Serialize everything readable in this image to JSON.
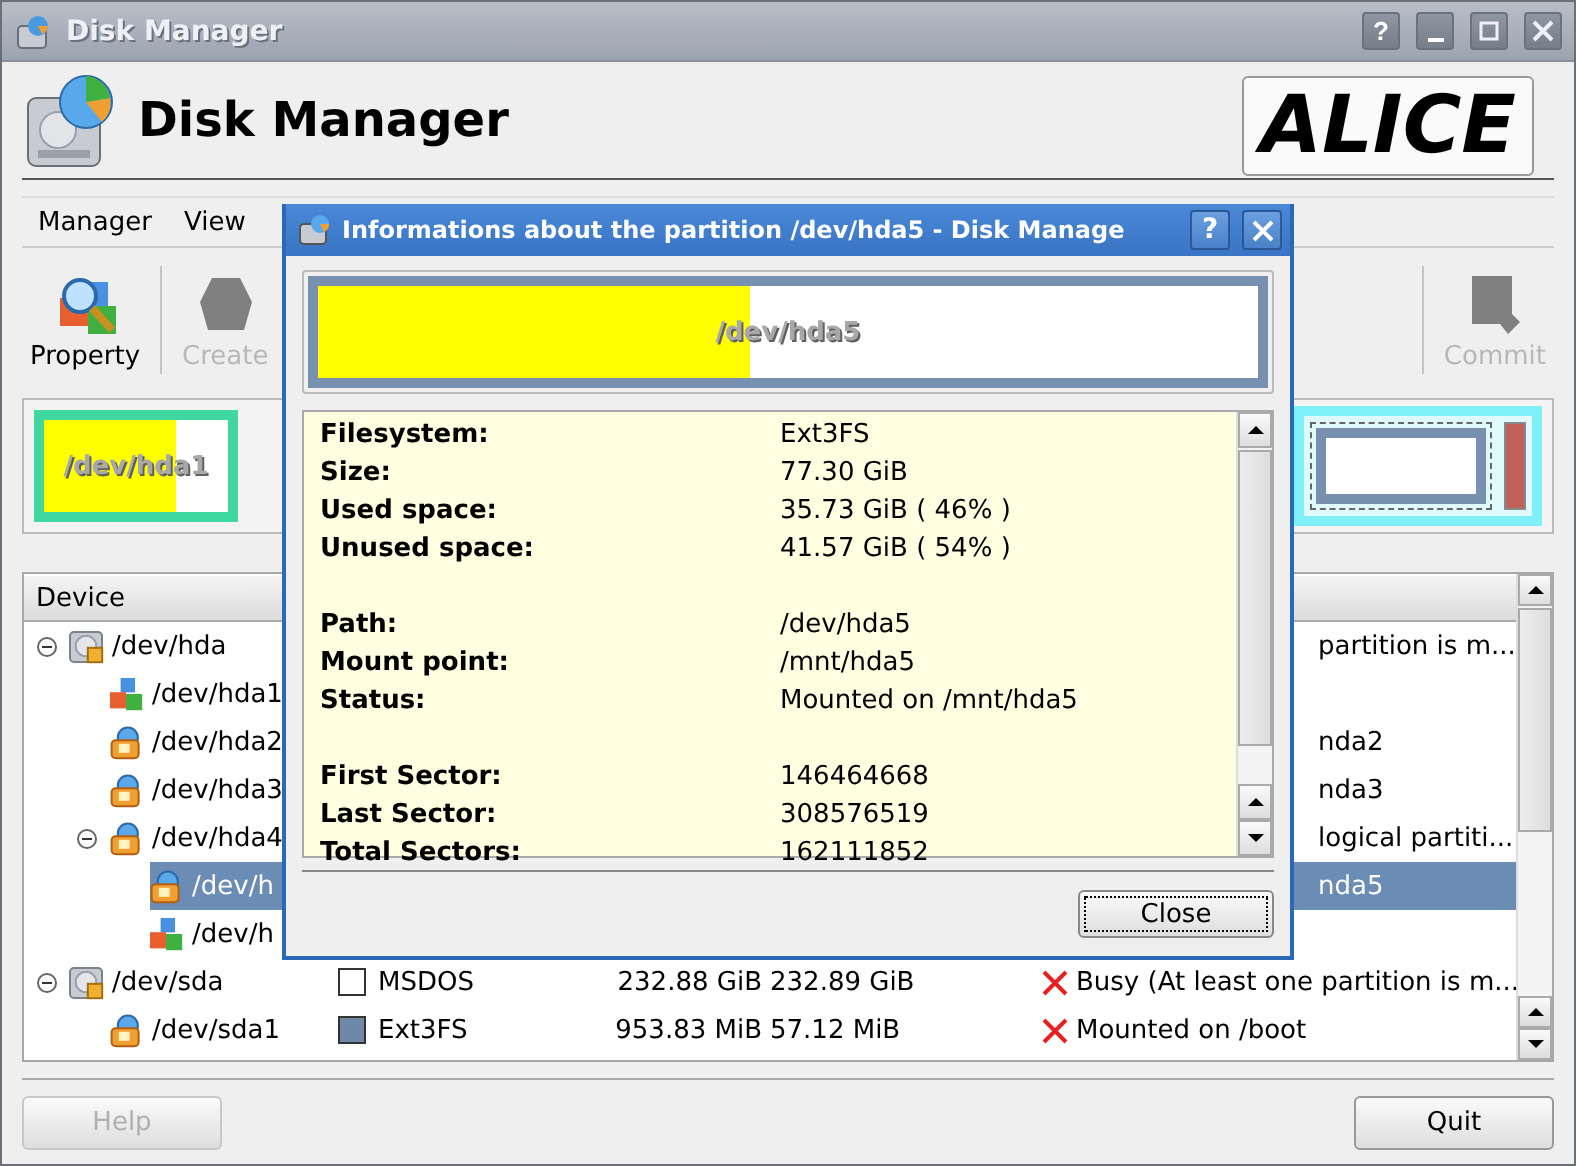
{
  "window": {
    "title": "Disk Manager",
    "help_glyph": "?"
  },
  "header": {
    "title": "Disk Manager",
    "logo": "ALICE"
  },
  "menu": [
    {
      "label": "Manager"
    },
    {
      "label": "View"
    }
  ],
  "toolbar": {
    "left": [
      {
        "label": "Property",
        "disabled": false,
        "kind": "property"
      },
      {
        "label": "Create",
        "disabled": true,
        "kind": "create"
      }
    ],
    "right": [
      {
        "label": "Commit",
        "disabled": true,
        "kind": "commit"
      }
    ]
  },
  "partition_map": [
    {
      "label": "/dev/hda1",
      "level": 0.72
    }
  ],
  "table": {
    "columns": [
      "Device"
    ],
    "rows": [
      {
        "name": "/dev/hda",
        "kind": "disk",
        "expanded": true,
        "selected": false,
        "status": "partition is m...",
        "children": [
          {
            "name": "/dev/hda1",
            "kind": "free",
            "selected": false
          },
          {
            "name": "/dev/hda2",
            "kind": "mounted",
            "selected": false,
            "status": "nda2"
          },
          {
            "name": "/dev/hda3",
            "kind": "mounted",
            "selected": false,
            "status": "nda3"
          },
          {
            "name": "/dev/hda4",
            "kind": "mounted",
            "expanded": true,
            "selected": false,
            "status": "logical partiti...",
            "children": [
              {
                "name": "/dev/h",
                "kind": "mounted",
                "selected": true,
                "status": "nda5"
              },
              {
                "name": "/dev/h",
                "kind": "free",
                "selected": false
              }
            ]
          }
        ]
      },
      {
        "name": "/dev/sda",
        "kind": "disk",
        "expanded": true,
        "selected": false,
        "filesystem": "MSDOS",
        "color": "#ffffff",
        "size": "232.88 GiB",
        "used": "232.89 GiB",
        "status": "Busy (At least one partition is m...",
        "children": [
          {
            "name": "/dev/sda1",
            "kind": "mounted",
            "selected": false,
            "filesystem": "Ext3FS",
            "color": "#7088a8",
            "size": "953.83 MiB",
            "used": "57.12 MiB",
            "status": "Mounted on /boot"
          }
        ]
      }
    ]
  },
  "buttons": [
    {
      "label": "Help",
      "disabled": true
    },
    {
      "label": "Quit",
      "disabled": false
    }
  ],
  "dialog": {
    "title": "Informations about the partition /dev/hda5 - Disk Manage",
    "help_glyph": "?",
    "bar": {
      "label": "/dev/hda5",
      "level": 0.46
    },
    "groups": [
      [
        {
          "label": "Filesystem:",
          "value": "Ext3FS"
        },
        {
          "label": "Size:",
          "value": "77.30 GiB"
        },
        {
          "label": "Used space:",
          "value": "35.73 GiB ( 46% )"
        },
        {
          "label": "Unused space:",
          "value": "41.57 GiB ( 54% )"
        }
      ],
      [
        {
          "label": "Path:",
          "value": "/dev/hda5"
        },
        {
          "label": "Mount point:",
          "value": "/mnt/hda5"
        },
        {
          "label": "Status:",
          "value": "Mounted on /mnt/hda5"
        }
      ],
      [
        {
          "label": "First Sector:",
          "value": "146464668"
        },
        {
          "label": "Last Sector:",
          "value": "308576519"
        },
        {
          "label": "Total Sectors:",
          "value": "162111852"
        }
      ]
    ],
    "button": "Close"
  }
}
